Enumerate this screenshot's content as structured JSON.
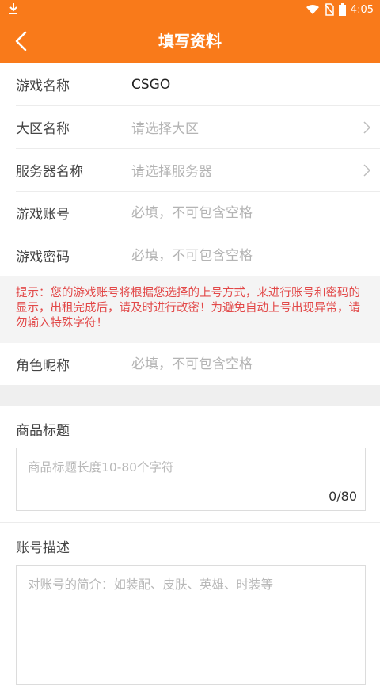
{
  "status_bar": {
    "time": "4:05"
  },
  "header": {
    "title": "填写资料"
  },
  "form": {
    "game_name": {
      "label": "游戏名称",
      "value": "CSGO"
    },
    "region": {
      "label": "大区名称",
      "placeholder": "请选择大区"
    },
    "server": {
      "label": "服务器名称",
      "placeholder": "请选择服务器"
    },
    "account": {
      "label": "游戏账号",
      "placeholder": "必填，不可包含空格"
    },
    "password": {
      "label": "游戏密码",
      "placeholder": "必填，不可包含空格"
    },
    "notice": "提示：您的游戏账号将根据您选择的上号方式，来进行账号和密码的显示，出租完成后，请及时进行改密！为避免自动上号出现异常，请勿输入特殊字符！",
    "nickname": {
      "label": "角色昵称",
      "placeholder": "必填，不可包含空格"
    }
  },
  "product_title": {
    "label": "商品标题",
    "placeholder": "商品标题长度10-80个字符",
    "counter": "0/80"
  },
  "account_desc": {
    "label": "账号描述",
    "placeholder": "对账号的简介：如装配、皮肤、英雄、时装等"
  },
  "colors": {
    "accent": "#f97a1a",
    "notice": "#e24848"
  }
}
